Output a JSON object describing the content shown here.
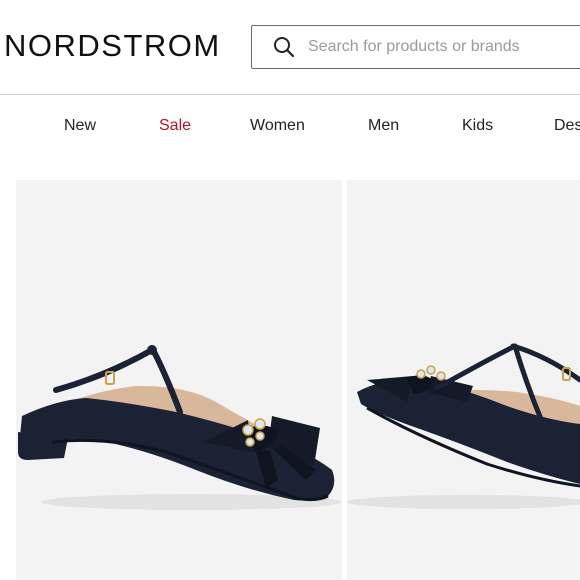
{
  "header": {
    "logo_text": "NORDSTROM",
    "search": {
      "placeholder": "Search for products or brands"
    }
  },
  "nav": {
    "items": [
      {
        "label": "New"
      },
      {
        "label": "Sale"
      },
      {
        "label": "Women"
      },
      {
        "label": "Men"
      },
      {
        "label": "Kids"
      },
      {
        "label": "Des"
      }
    ]
  },
  "colors": {
    "sale_accent": "#b0132a",
    "tile_background": "#f3f3f3",
    "shoe_navy": "#1b2233"
  },
  "products": [
    {
      "image": "navy satin bow t-strap mule, side view"
    },
    {
      "image": "navy satin bow t-strap mule, angled view"
    }
  ]
}
